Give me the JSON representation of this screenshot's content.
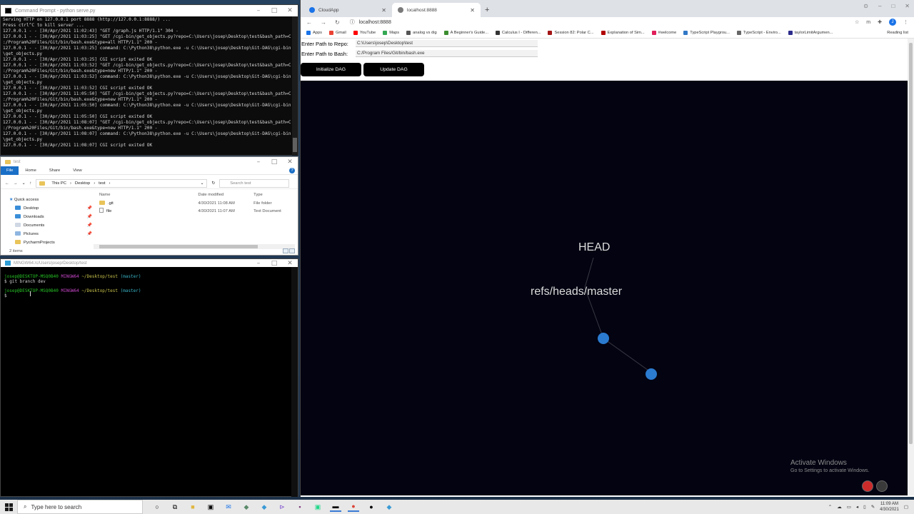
{
  "cmd": {
    "title": "Command Prompt - python  serve.py",
    "lines": [
      "Serving HTTP on 127.0.0.1 port 8888 (http://127.0.0.1:8888/) ...",
      "Press ctrl^C to kill server ...",
      "127.0.0.1 - - [30/Apr/2021 11:02:43] \"GET /graph.js HTTP/1.1\" 304 -",
      "127.0.0.1 - - [30/Apr/2021 11:03:25] \"GET /cgi-bin/get_objects.py?repo=C:\\Users\\josep\\Desktop\\test&bash_path=C",
      ":/Program%20Files/Git/bin/bash.exe&type=all HTTP/1.1\" 200 -",
      "127.0.0.1 - - [30/Apr/2021 11:03:25] command: C:\\Python38\\python.exe -u C:\\Users\\josep\\Desktop\\Git-DAG\\cgi-bin",
      "\\get_objects.py",
      "127.0.0.1 - - [30/Apr/2021 11:03:25] CGI script exited OK",
      "127.0.0.1 - - [30/Apr/2021 11:03:52] \"GET /cgi-bin/get_objects.py?repo=C:\\Users\\josep\\Desktop\\test&bash_path=C",
      ":/Program%20Files/Git/bin/bash.exe&type=new HTTP/1.1\" 200 -",
      "127.0.0.1 - - [30/Apr/2021 11:03:52] command: C:\\Python38\\python.exe -u C:\\Users\\josep\\Desktop\\Git-DAG\\cgi-bin",
      "\\get_objects.py",
      "127.0.0.1 - - [30/Apr/2021 11:03:52] CGI script exited OK",
      "127.0.0.1 - - [30/Apr/2021 11:05:50] \"GET /cgi-bin/get_objects.py?repo=C:\\Users\\josep\\Desktop\\test&bash_path=C",
      ":/Program%20Files/Git/bin/bash.exe&type=new HTTP/1.1\" 200 -",
      "127.0.0.1 - - [30/Apr/2021 11:05:50] command: C:\\Python38\\python.exe -u C:\\Users\\josep\\Desktop\\Git-DAG\\cgi-bin",
      "\\get_objects.py",
      "127.0.0.1 - - [30/Apr/2021 11:05:50] CGI script exited OK",
      "127.0.0.1 - - [30/Apr/2021 11:08:07] \"GET /cgi-bin/get_objects.py?repo=C:\\Users\\josep\\Desktop\\test&bash_path=C",
      ":/Program%20Files/Git/bin/bash.exe&type=new HTTP/1.1\" 200 -",
      "127.0.0.1 - - [30/Apr/2021 11:08:07] command: C:\\Python38\\python.exe -u C:\\Users\\josep\\Desktop\\Git-DAG\\cgi-bin",
      "\\get_objects.py",
      "127.0.0.1 - - [30/Apr/2021 11:08:07] CGI script exited OK"
    ]
  },
  "explorer": {
    "title": "test",
    "ribbon": {
      "file": "File",
      "home": "Home",
      "share": "Share",
      "view": "View"
    },
    "breadcrumb": [
      "This PC",
      "Desktop",
      "test"
    ],
    "search_placeholder": "Search test",
    "nav": {
      "quick_access": "Quick access",
      "desktop": "Desktop",
      "downloads": "Downloads",
      "documents": "Documents",
      "pictures": "Pictures",
      "pycharm": "PycharmProjects"
    },
    "columns": {
      "name": "Name",
      "date": "Date modified",
      "type": "Type"
    },
    "rows": [
      {
        "name": ".git",
        "date": "4/30/2021 11:08 AM",
        "type": "File folder"
      },
      {
        "name": "file",
        "date": "4/30/2021 11:07 AM",
        "type": "Text Document"
      }
    ],
    "status": "2 items"
  },
  "bash": {
    "title": "MINGW64:/c/Users/josep/Desktop/test",
    "prompt_user": "josep@DESKTOP-MSQ0B40",
    "prompt_env": "MINGW64",
    "prompt_path": "~/Desktop/test",
    "prompt_branch": "(master)",
    "command1": "$ git branch dev",
    "prompt2_rest": "$"
  },
  "browser": {
    "tabs": [
      {
        "label": "CloudApp"
      },
      {
        "label": "localhost:8888"
      }
    ],
    "url": "localhost:8888",
    "bookmarks": [
      "Apps",
      "Gmail",
      "YouTube",
      "Maps",
      "analog vs dig",
      "A Beginner's Guide...",
      "Calculus I - Differen...",
      "Session 82: Polar C...",
      "Explanation of Sim...",
      "#welcome",
      "TypeScript Playgrou...",
      "TypeScript - Enviro...",
      "taylorLimitArgumen..."
    ],
    "reading_list": "Reading list",
    "avatar_letter": "J",
    "form": {
      "repo_label": "Enter Path to Repo:",
      "repo_value": "C:\\Users\\josep\\Desktop\\test",
      "bash_label": "Enter Path to Bash:",
      "bash_value": "C:/Program Files/Git/bin/bash.exe"
    },
    "buttons": {
      "init": "Initialize DAG",
      "update": "Update DAG"
    },
    "graph": {
      "node_labels": {
        "head": "HEAD",
        "master": "refs/heads/master"
      },
      "commit_color": "#2b7bd0"
    },
    "watermark": {
      "line1": "Activate Windows",
      "line2": "Go to Settings to activate Windows."
    }
  },
  "taskbar": {
    "search_placeholder": "Type here to search",
    "time": "11:09 AM",
    "date": "4/30/2021"
  }
}
